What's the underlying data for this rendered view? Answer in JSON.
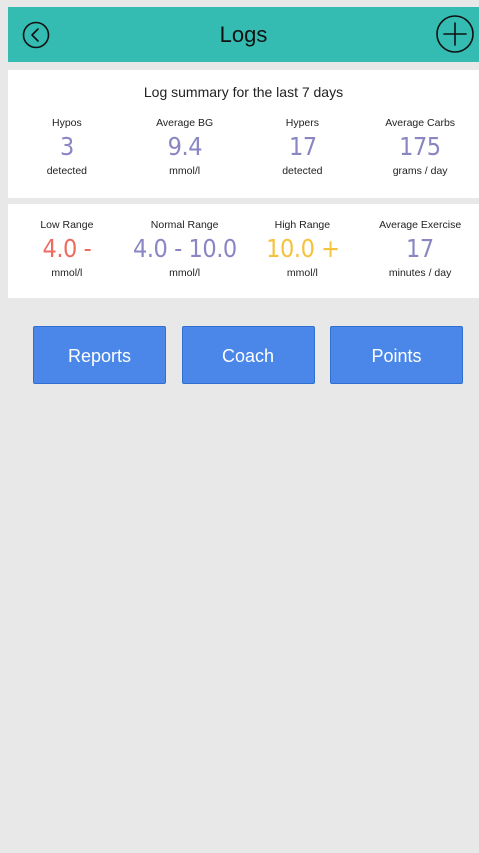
{
  "header": {
    "title": "Logs",
    "color": "#34bcb3"
  },
  "summary": {
    "title": "Log summary for the last 7 days",
    "stats": [
      {
        "label": "Hypos",
        "value": "3",
        "unit": "detected",
        "color": "#8a86c4"
      },
      {
        "label": "Average BG",
        "value": "9.4",
        "unit": "mmol/l",
        "color": "#8a86c4"
      },
      {
        "label": "Hypers",
        "value": "17",
        "unit": "detected",
        "color": "#8a86c4"
      },
      {
        "label": "Average Carbs",
        "value": "175",
        "unit": "grams / day",
        "color": "#8a86c4"
      }
    ]
  },
  "ranges": {
    "stats": [
      {
        "label": "Low Range",
        "value": "4.0 -",
        "unit": "mmol/l",
        "color": "#ee6b60"
      },
      {
        "label": "Normal Range",
        "value": "4.0 - 10.0",
        "unit": "mmol/l",
        "color": "#8a86c4"
      },
      {
        "label": "High Range",
        "value": "10.0 +",
        "unit": "mmol/l",
        "color": "#f6c23e"
      },
      {
        "label": "Average Exercise",
        "value": "17",
        "unit": "minutes / day",
        "color": "#8a86c4"
      }
    ]
  },
  "actions": {
    "reports_label": "Reports",
    "coach_label": "Coach",
    "points_label": "Points",
    "button_color": "#4a87e8"
  },
  "icons": {
    "back": "back-circle-icon",
    "add": "add-circle-icon"
  }
}
